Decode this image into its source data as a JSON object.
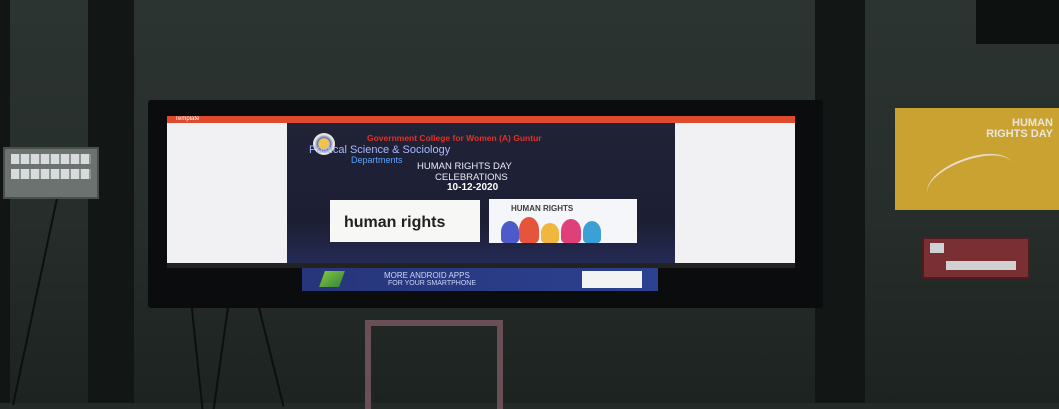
{
  "scene": {
    "description_icon": "classroom-tv-photo"
  },
  "tv_screen": {
    "top_bar_label": "Template",
    "slide": {
      "college": "Government College for Women (A) Guntur",
      "department_line1": "Political Science & Sociology",
      "department_line2": "Departments",
      "event_line1": "HUMAN RIGHTS DAY",
      "event_line2": "CELEBRATIONS",
      "date": "10-12-2020",
      "image1_text": "human rights",
      "image2_text": "HUMAN RIGHTS"
    }
  },
  "ad_banner": {
    "line1": "MORE ANDROID APPS",
    "line2": "FOR YOUR SMARTPHONE"
  },
  "wall_poster": {
    "title": "HUMAN RIGHTS DAY"
  },
  "colors": {
    "slide_bg": "#202236",
    "college_text": "#e03226",
    "department_text": "#a8b8ff",
    "poster": "#c9a232"
  }
}
